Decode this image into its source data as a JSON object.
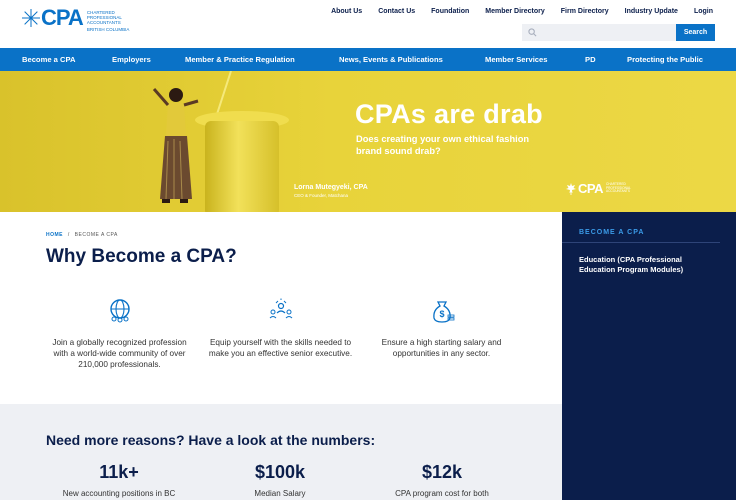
{
  "logo": {
    "mark": "CPA",
    "sub": "Chartered Professional Accountants",
    "region": "British Columbia"
  },
  "toplinks": [
    "About Us",
    "Contact Us",
    "Foundation",
    "Member Directory",
    "Firm Directory",
    "Industry Update",
    "Login"
  ],
  "search": {
    "placeholder": "",
    "button": "Search"
  },
  "nav": [
    "Become a CPA",
    "Employers",
    "Member & Practice Regulation",
    "News, Events & Publications",
    "Member Services",
    "PD",
    "Protecting the Public"
  ],
  "hero": {
    "title": "CPAs are drab",
    "subtitle": "Does creating your own ethical fashion brand sound drab?",
    "name": "Lorna Mutegyeki, CPA",
    "role": "CEO & Founder, Matchana",
    "logo": "CPA",
    "logo_sub": "Chartered Professional Accountants"
  },
  "breadcrumb": {
    "home": "HOME",
    "sep": "/",
    "current": "BECOME A CPA"
  },
  "page_title": "Why Become a CPA?",
  "features": [
    {
      "icon": "globe-people-icon",
      "text": "Join a globally recognized profession with a world-wide community of over 210,000 professionals."
    },
    {
      "icon": "skills-people-icon",
      "text": "Equip yourself with the skills needed to make you an effective senior executive."
    },
    {
      "icon": "money-bag-icon",
      "text": "Ensure a high starting salary and opportunities in any sector."
    }
  ],
  "reasons": {
    "title": "Need more reasons? Have a look at the numbers:",
    "stats": [
      {
        "value": "11k+",
        "label": "New accounting positions in BC"
      },
      {
        "value": "$100k",
        "label": "Median Salary"
      },
      {
        "value": "$12k",
        "label": "CPA program cost for both"
      }
    ]
  },
  "sidebar": {
    "title": "BECOME A CPA",
    "link": "Education (CPA Professional Education Program Modules)"
  },
  "colors": {
    "brand_blue": "#0a72c7",
    "navy": "#0b1e4b",
    "hero_yellow": "#e8d33a"
  }
}
